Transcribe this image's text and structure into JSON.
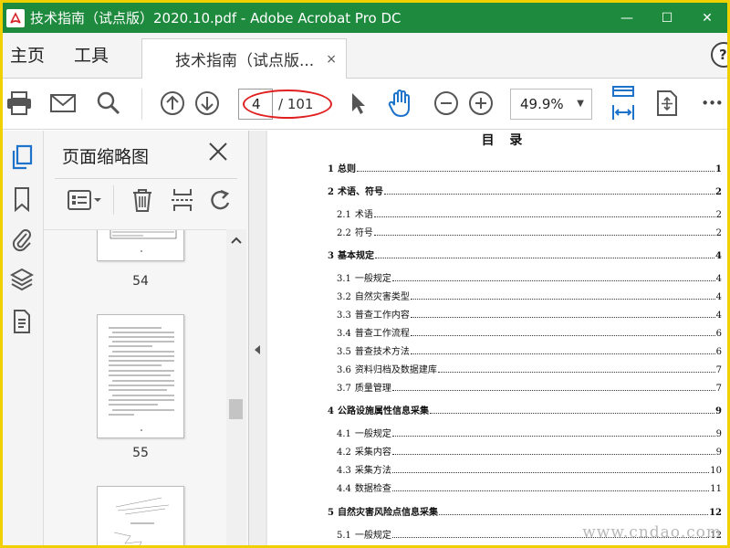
{
  "window": {
    "title": "技术指南（试点版）2020.10.pdf - Adobe Acrobat Pro DC",
    "minimize": "—",
    "maximize": "☐",
    "close": "✕"
  },
  "tabs": {
    "home": "主页",
    "tools": "工具",
    "document": "技术指南（试点版...",
    "close": "×",
    "help": "?"
  },
  "toolbar": {
    "page_current": "4",
    "page_total": "/ 101",
    "zoom": "49.9%",
    "zoom_arrow": "▼",
    "more": "•••"
  },
  "thumbnails": {
    "title": "页面缩略图",
    "pages": [
      {
        "label": "54"
      },
      {
        "label": "55"
      }
    ]
  },
  "document": {
    "heading": "目 录",
    "toc": [
      {
        "num": "1",
        "text": "总则",
        "page": "1",
        "chapter": true
      },
      {
        "num": "2",
        "text": "术语、符号",
        "page": "2",
        "chapter": true
      },
      {
        "num": "2.1",
        "text": "术语",
        "page": "2",
        "chapter": false
      },
      {
        "num": "2.2",
        "text": "符号",
        "page": "2",
        "chapter": false
      },
      {
        "num": "3",
        "text": "基本规定",
        "page": "4",
        "chapter": true
      },
      {
        "num": "3.1",
        "text": "一般规定",
        "page": "4",
        "chapter": false
      },
      {
        "num": "3.2",
        "text": "自然灾害类型",
        "page": "4",
        "chapter": false
      },
      {
        "num": "3.3",
        "text": "普查工作内容",
        "page": "4",
        "chapter": false
      },
      {
        "num": "3.4",
        "text": "普查工作流程",
        "page": "6",
        "chapter": false
      },
      {
        "num": "3.5",
        "text": "普查技术方法",
        "page": "6",
        "chapter": false
      },
      {
        "num": "3.6",
        "text": "资料归档及数据建库",
        "page": "7",
        "chapter": false
      },
      {
        "num": "3.7",
        "text": "质量管理",
        "page": "7",
        "chapter": false
      },
      {
        "num": "4",
        "text": "公路设施属性信息采集",
        "page": "9",
        "chapter": true
      },
      {
        "num": "4.1",
        "text": "一般规定",
        "page": "9",
        "chapter": false
      },
      {
        "num": "4.2",
        "text": "采集内容",
        "page": "9",
        "chapter": false
      },
      {
        "num": "4.3",
        "text": "采集方法",
        "page": "10",
        "chapter": false
      },
      {
        "num": "4.4",
        "text": "数据检查",
        "page": "11",
        "chapter": false
      },
      {
        "num": "5",
        "text": "自然灾害风险点信息采集",
        "page": "12",
        "chapter": true
      },
      {
        "num": "5.1",
        "text": "一般规定",
        "page": "12",
        "chapter": false
      }
    ]
  },
  "watermark": "www.cndao.com",
  "colors": {
    "titlebar": "#1e8a3e",
    "accent_blue": "#1d72c9",
    "highlight_red": "#e02020",
    "outer_border": "#f0d000"
  }
}
